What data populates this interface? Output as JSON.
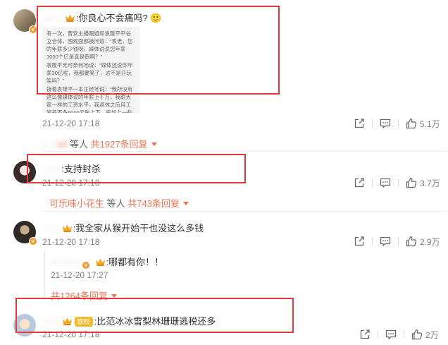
{
  "comments": [
    {
      "username": "··· ··",
      "text": ":你良心不会痛吗? 🙂",
      "image_lines": [
        "有一次，曹安主播跟姐和袁隆平平谷立合体，围观面都被问道：“袁老，您的年薪多少钱呀，媒体说说您年薪1000个亿是真是假啊？”",
        "袁隆平无可奈何地说：“媒体还说你年薪30亿呢，我都要笑了，这不是开玩笑吗？”",
        "接着袁隆平一本正经地说：“我所没有这么像媒体说的年薪上千万，我跟大家一样的工资水平，我退休之后月工资差不多6000元钱上下，再加上一些国家科学研究奖，袁老就有个三十万的样子。”"
      ],
      "time": "21-12-20 17:18",
      "likes": "5.1万",
      "replies_by": "·· ··10",
      "replies_suffix": " 等人 ",
      "replies_link": "共1927条回复"
    },
    {
      "username": "··· ··",
      "text": ":支持封杀",
      "time": "21-12-20 17:18",
      "likes": "3.7万",
      "replies_by": "可乐味小花生",
      "replies_suffix": " 等人 ",
      "replies_link": "共743条回复"
    },
    {
      "username": "·· ··",
      "text": ":我全家从猴开始干也没这么多钱",
      "time": "21-12-20 17:18",
      "likes": "2.9万",
      "reply": {
        "username": "··· ·····",
        "text": ":哪都有你！！",
        "time": "21-12-20 17:27"
      },
      "replies_link": "共1264条回复"
    },
    {
      "username": "·· ··",
      "fan_badge": "铁粉",
      "text": ":比范冰冰雪梨林珊珊逃税还多",
      "time": "21-12-20 17:18",
      "likes": "2万"
    }
  ],
  "colors": {
    "accent": "#eb7350",
    "highlight_box": "#e23a3a",
    "meta_text": "#808080",
    "verified_badge": "#f29a2e"
  },
  "icons": {
    "share": "share-icon",
    "comment": "comment-icon",
    "like": "thumbs-up-icon",
    "verified": "verified-badge-icon",
    "crown": "crown-badge-icon",
    "emoji": "smiley-emoji-icon"
  }
}
